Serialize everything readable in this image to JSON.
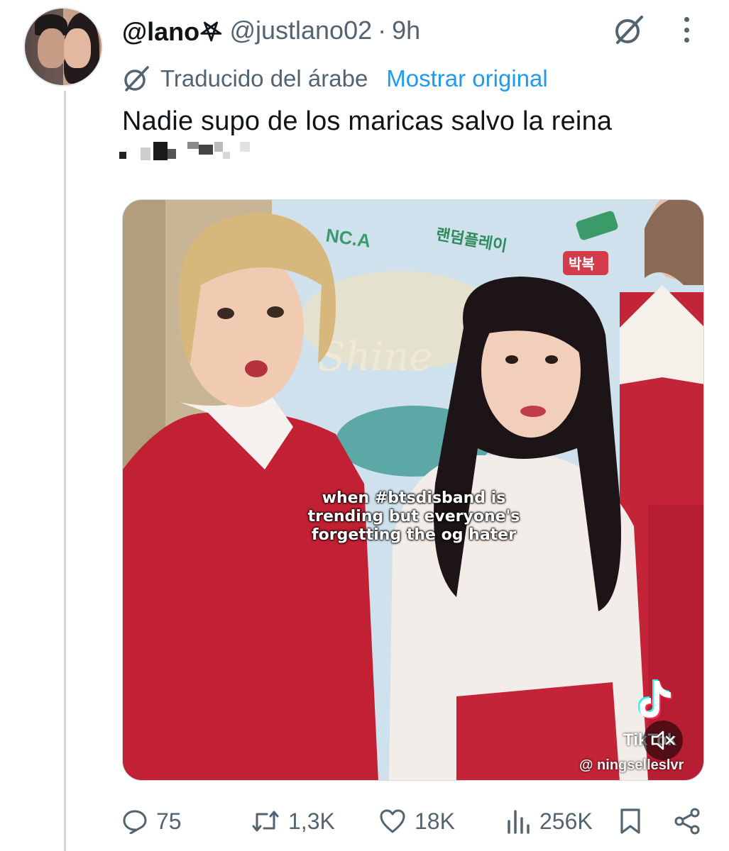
{
  "author": {
    "display_name": "@lano𖤐",
    "handle": "@justlano02",
    "separator": "·",
    "time": "9h"
  },
  "translation": {
    "label": "Traducido del árabe",
    "show_original": "Mostrar original"
  },
  "tweet": {
    "text": "Nadie supo de los maricas salvo la reina"
  },
  "media": {
    "caption_lines": [
      "when #btsdisband is",
      "trending but everyone's",
      "forgetting the og hater"
    ],
    "background_signs": [
      "NC.A",
      "Shine",
      "랜덤플레이",
      "박복"
    ],
    "platform_word": "TikTok",
    "watermark": "@ ningselleslvr"
  },
  "actions": {
    "replies": "75",
    "reposts": "1,3K",
    "likes": "18K",
    "views": "256K"
  },
  "colors": {
    "accent": "#1d9bf0",
    "muted": "#536471",
    "text": "#0f1419",
    "thread_line": "#cfd9de"
  },
  "icons": [
    "grok-icon",
    "more-icon",
    "translate-icon",
    "reply-icon",
    "repost-icon",
    "like-icon",
    "views-icon",
    "bookmark-icon",
    "share-icon",
    "tiktok-logo-icon",
    "mute-icon"
  ]
}
